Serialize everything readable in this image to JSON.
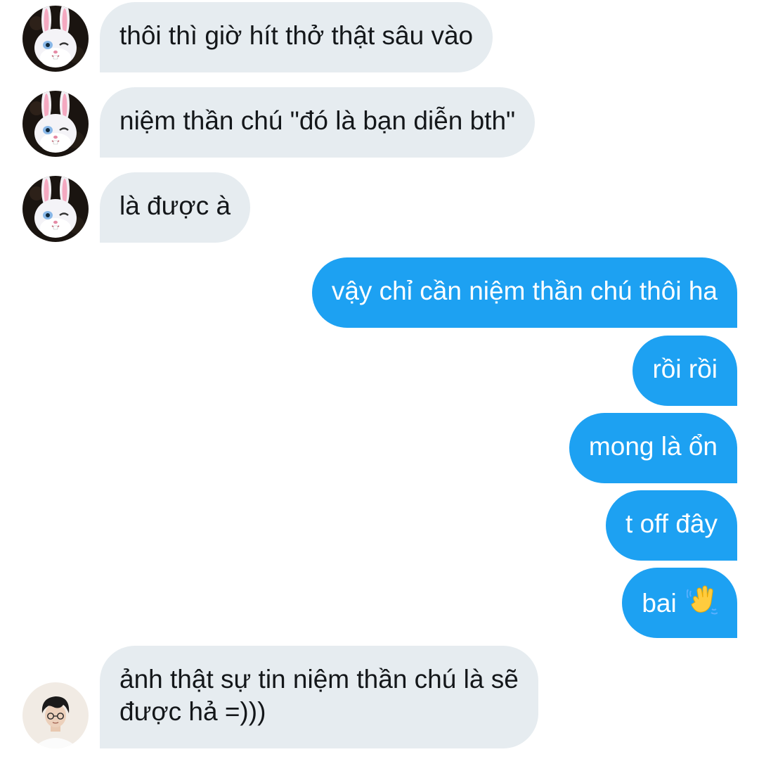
{
  "messages": [
    {
      "side": "incoming",
      "avatar": "bunny-avatar",
      "text": "thôi thì giờ hít thở thật sâu vào"
    },
    {
      "side": "incoming",
      "avatar": "bunny-avatar",
      "text": "niệm thần chú \"đó là bạn diễn bth\""
    },
    {
      "side": "incoming",
      "avatar": "bunny-avatar",
      "text": "là được à"
    },
    {
      "side": "outgoing",
      "text": "vậy chỉ cần niệm thần chú thôi ha"
    },
    {
      "side": "outgoing",
      "text": "rồi rồi"
    },
    {
      "side": "outgoing",
      "text": "mong là ổn"
    },
    {
      "side": "outgoing",
      "text": "t off đây"
    },
    {
      "side": "outgoing",
      "text": "bai",
      "emoji": "waving-hand-icon"
    },
    {
      "side": "incoming",
      "avatar": "person-avatar",
      "lines": [
        "ảnh thật sự tin niệm thần chú là sẽ",
        "được hả =)))"
      ]
    }
  ],
  "colors": {
    "incoming_bubble": "#e6ecf0",
    "incoming_text": "#14171a",
    "outgoing_bubble": "#1da1f2",
    "outgoing_text": "#ffffff"
  }
}
